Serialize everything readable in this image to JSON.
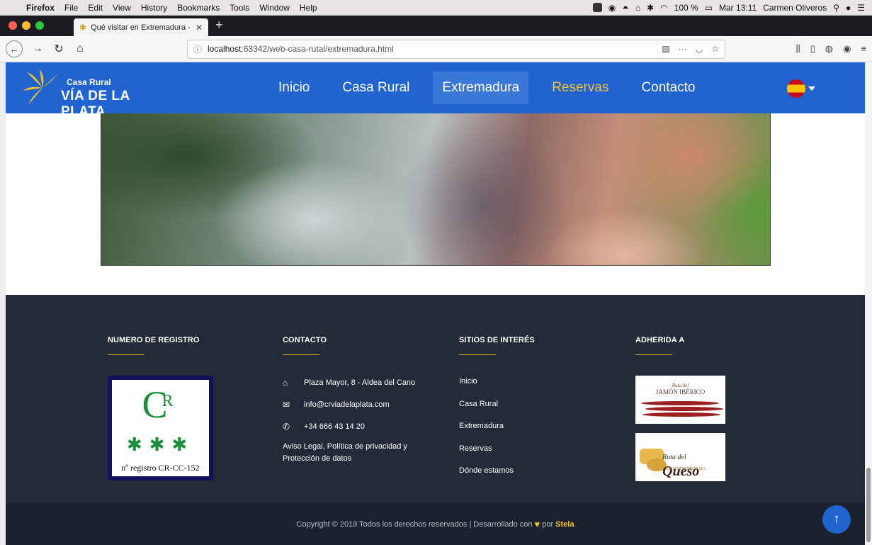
{
  "macos_menubar": {
    "app": "Firefox",
    "menus": [
      "File",
      "Edit",
      "View",
      "History",
      "Bookmarks",
      "Tools",
      "Window",
      "Help"
    ],
    "battery": "100 %",
    "clock": "Mar 13:11",
    "user": "Carmen Oliveros"
  },
  "browser": {
    "tab_title": "Qué visitar en Extremadura - C",
    "url_host": "localhost",
    "url_rest": ":63342/web-casa-rutal/extremadura.html"
  },
  "site": {
    "logo_small": "Casa Rural",
    "logo_big": "VÍA DE LA PLATA",
    "nav": [
      {
        "label": "Inicio"
      },
      {
        "label": "Casa Rural"
      },
      {
        "label": "Extremadura"
      },
      {
        "label": "Reservas"
      },
      {
        "label": "Contacto"
      }
    ],
    "active_nav": "Extremadura"
  },
  "footer": {
    "registro": {
      "heading": "NUMERO DE REGISTRO",
      "badge_letters": "C",
      "badge_sub": "R",
      "badge_stars": "✱✱✱",
      "badge_number": "nº registro CR-CC-152"
    },
    "contacto": {
      "heading": "CONTACTO",
      "address": "Plaza Mayor, 8 - Aldea del Cano",
      "email": "info@crviadelaplata.com",
      "phone": "+34 666 43 14 20",
      "legal": "Aviso Legal, Política de privacidad y Protección de datos"
    },
    "sitios": {
      "heading": "SITIOS DE INTERÉS",
      "links": [
        "Inicio",
        "Casa Rural",
        "Extremadura",
        "Reservas",
        "Dónde estamos"
      ]
    },
    "adherida": {
      "heading": "ADHERIDA A",
      "logo1_top": "Ruta del",
      "logo1_main": "JAMÓN IBÉRICO",
      "logo2_pre": "Ruta del",
      "logo2_main": "Queso",
      "logo2_sub": "DE EXTREMADURA"
    },
    "copyright_text": "Copyright © 2019 Todos los derechos reservados | Desarrollado con",
    "copyright_by": "por",
    "copyright_author": "Stela"
  },
  "colors": {
    "site_nav": "#2163cf",
    "accent_gold": "#f2c12e",
    "footer_bg": "#232b38",
    "copyright_bg": "#1b222d"
  },
  "icons": {
    "address": "home-icon",
    "email": "envelope-icon",
    "phone": "phone-icon",
    "back_to_top": "arrow-up-icon"
  }
}
